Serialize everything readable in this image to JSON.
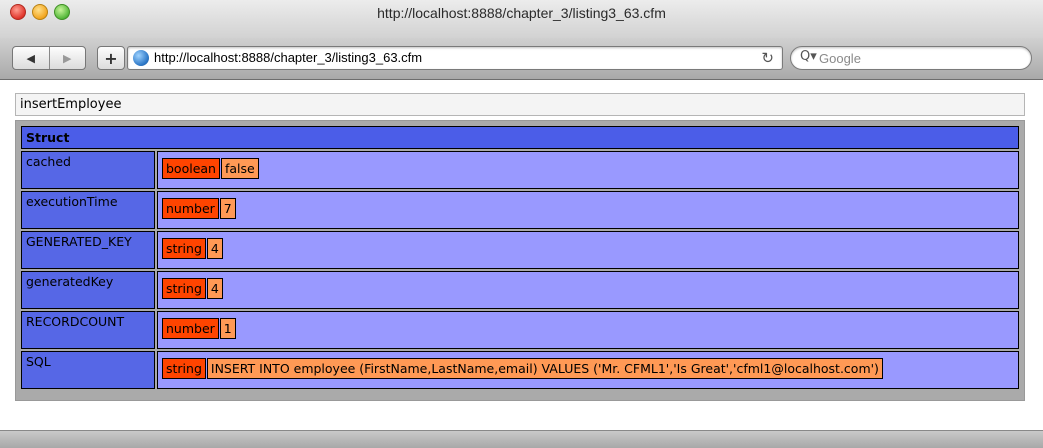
{
  "window": {
    "title": "http://localhost:8888/chapter_3/listing3_63.cfm"
  },
  "toolbar": {
    "back_glyph": "◀",
    "forward_glyph": "▶",
    "add_glyph": "+",
    "url": "http://localhost:8888/chapter_3/listing3_63.cfm",
    "reload_glyph": "↻",
    "search_icon_glyph": "Q▾",
    "search_placeholder": "Google"
  },
  "dump": {
    "label": "insertEmployee",
    "struct_header": "Struct",
    "rows": [
      {
        "key": "cached",
        "type": "boolean",
        "value": "false"
      },
      {
        "key": "executionTime",
        "type": "number",
        "value": "7"
      },
      {
        "key": "GENERATED_KEY",
        "type": "string",
        "value": "4"
      },
      {
        "key": "generatedKey",
        "type": "string",
        "value": "4"
      },
      {
        "key": "RECORDCOUNT",
        "type": "number",
        "value": "1"
      },
      {
        "key": "SQL",
        "type": "string",
        "value": "INSERT INTO employee (FirstName,LastName,email) VALUES ('Mr. CFML1','Is Great','cfml1@localhost.com')"
      }
    ]
  },
  "colors": {
    "struct_header": "#4b5de8",
    "key_cell": "#5667e6",
    "value_cell": "#9999ff",
    "type_badge": "#ff4400",
    "value_badge": "#ff9955"
  },
  "icons": {
    "close": "close-icon",
    "minimize": "minimize-icon",
    "maximize": "maximize-icon",
    "site": "globe-icon",
    "reload": "reload-icon",
    "search": "search-icon"
  }
}
